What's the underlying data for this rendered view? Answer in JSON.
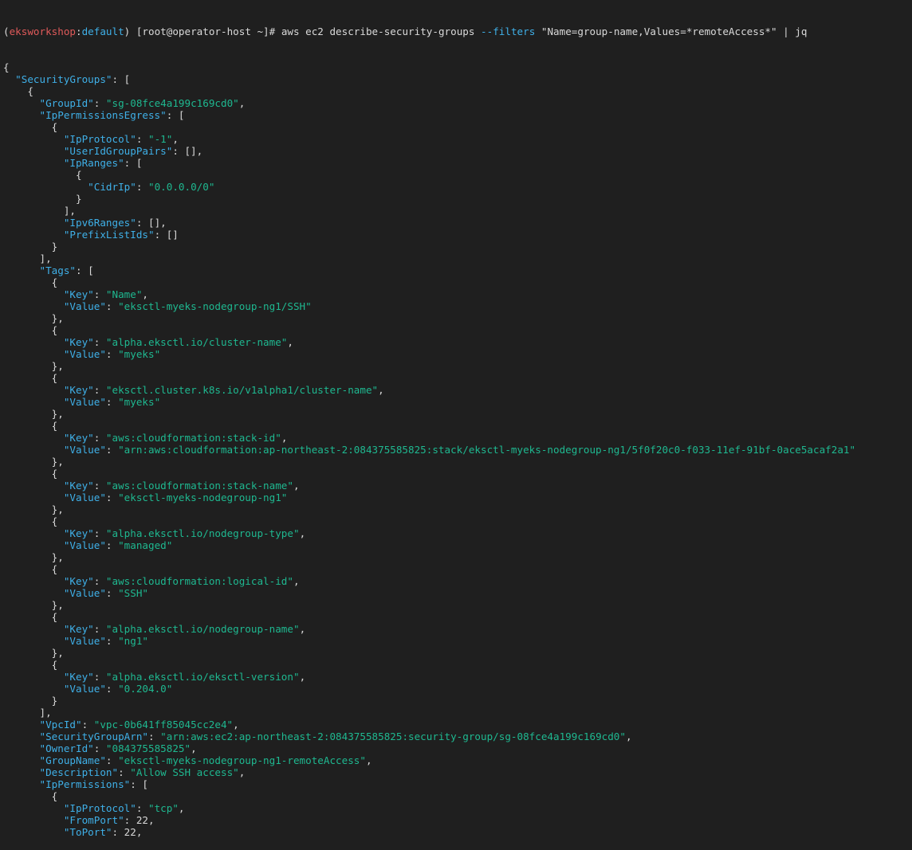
{
  "colors": {
    "background": "#1f1f1f",
    "foreground": "#d9d9d9",
    "json_key": "#3fb0e8",
    "json_string": "#1fb890",
    "prompt_context": "#e05a5a",
    "prompt_namespace": "#3fb0e8"
  },
  "prompt": {
    "open_paren": "(",
    "context": "eksworkshop",
    "colon": ":",
    "namespace": "default",
    "close_and_host": ") [root@operator-host ~]# ",
    "cmd_before_flag": "aws ec2 describe-security-groups ",
    "flag": "--filters",
    "cmd_after_flag": " \"Name=group-name,Values=*remoteAccess*\" | jq"
  },
  "lines": [
    [
      {
        "t": "p",
        "v": "{"
      }
    ],
    [
      {
        "t": "p",
        "v": "  "
      },
      {
        "t": "k",
        "v": "\"SecurityGroups\""
      },
      {
        "t": "p",
        "v": ": ["
      }
    ],
    [
      {
        "t": "p",
        "v": "    {"
      }
    ],
    [
      {
        "t": "p",
        "v": "      "
      },
      {
        "t": "k",
        "v": "\"GroupId\""
      },
      {
        "t": "p",
        "v": ": "
      },
      {
        "t": "s",
        "v": "\"sg-08fce4a199c169cd0\""
      },
      {
        "t": "p",
        "v": ","
      }
    ],
    [
      {
        "t": "p",
        "v": "      "
      },
      {
        "t": "k",
        "v": "\"IpPermissionsEgress\""
      },
      {
        "t": "p",
        "v": ": ["
      }
    ],
    [
      {
        "t": "p",
        "v": "        {"
      }
    ],
    [
      {
        "t": "p",
        "v": "          "
      },
      {
        "t": "k",
        "v": "\"IpProtocol\""
      },
      {
        "t": "p",
        "v": ": "
      },
      {
        "t": "s",
        "v": "\"-1\""
      },
      {
        "t": "p",
        "v": ","
      }
    ],
    [
      {
        "t": "p",
        "v": "          "
      },
      {
        "t": "k",
        "v": "\"UserIdGroupPairs\""
      },
      {
        "t": "p",
        "v": ": [],"
      }
    ],
    [
      {
        "t": "p",
        "v": "          "
      },
      {
        "t": "k",
        "v": "\"IpRanges\""
      },
      {
        "t": "p",
        "v": ": ["
      }
    ],
    [
      {
        "t": "p",
        "v": "            {"
      }
    ],
    [
      {
        "t": "p",
        "v": "              "
      },
      {
        "t": "k",
        "v": "\"CidrIp\""
      },
      {
        "t": "p",
        "v": ": "
      },
      {
        "t": "s",
        "v": "\"0.0.0.0/0\""
      }
    ],
    [
      {
        "t": "p",
        "v": "            }"
      }
    ],
    [
      {
        "t": "p",
        "v": "          ],"
      }
    ],
    [
      {
        "t": "p",
        "v": "          "
      },
      {
        "t": "k",
        "v": "\"Ipv6Ranges\""
      },
      {
        "t": "p",
        "v": ": [],"
      }
    ],
    [
      {
        "t": "p",
        "v": "          "
      },
      {
        "t": "k",
        "v": "\"PrefixListIds\""
      },
      {
        "t": "p",
        "v": ": []"
      }
    ],
    [
      {
        "t": "p",
        "v": "        }"
      }
    ],
    [
      {
        "t": "p",
        "v": "      ],"
      }
    ],
    [
      {
        "t": "p",
        "v": "      "
      },
      {
        "t": "k",
        "v": "\"Tags\""
      },
      {
        "t": "p",
        "v": ": ["
      }
    ],
    [
      {
        "t": "p",
        "v": "        {"
      }
    ],
    [
      {
        "t": "p",
        "v": "          "
      },
      {
        "t": "k",
        "v": "\"Key\""
      },
      {
        "t": "p",
        "v": ": "
      },
      {
        "t": "s",
        "v": "\"Name\""
      },
      {
        "t": "p",
        "v": ","
      }
    ],
    [
      {
        "t": "p",
        "v": "          "
      },
      {
        "t": "k",
        "v": "\"Value\""
      },
      {
        "t": "p",
        "v": ": "
      },
      {
        "t": "s",
        "v": "\"eksctl-myeks-nodegroup-ng1/SSH\""
      }
    ],
    [
      {
        "t": "p",
        "v": "        },"
      }
    ],
    [
      {
        "t": "p",
        "v": "        {"
      }
    ],
    [
      {
        "t": "p",
        "v": "          "
      },
      {
        "t": "k",
        "v": "\"Key\""
      },
      {
        "t": "p",
        "v": ": "
      },
      {
        "t": "s",
        "v": "\"alpha.eksctl.io/cluster-name\""
      },
      {
        "t": "p",
        "v": ","
      }
    ],
    [
      {
        "t": "p",
        "v": "          "
      },
      {
        "t": "k",
        "v": "\"Value\""
      },
      {
        "t": "p",
        "v": ": "
      },
      {
        "t": "s",
        "v": "\"myeks\""
      }
    ],
    [
      {
        "t": "p",
        "v": "        },"
      }
    ],
    [
      {
        "t": "p",
        "v": "        {"
      }
    ],
    [
      {
        "t": "p",
        "v": "          "
      },
      {
        "t": "k",
        "v": "\"Key\""
      },
      {
        "t": "p",
        "v": ": "
      },
      {
        "t": "s",
        "v": "\"eksctl.cluster.k8s.io/v1alpha1/cluster-name\""
      },
      {
        "t": "p",
        "v": ","
      }
    ],
    [
      {
        "t": "p",
        "v": "          "
      },
      {
        "t": "k",
        "v": "\"Value\""
      },
      {
        "t": "p",
        "v": ": "
      },
      {
        "t": "s",
        "v": "\"myeks\""
      }
    ],
    [
      {
        "t": "p",
        "v": "        },"
      }
    ],
    [
      {
        "t": "p",
        "v": "        {"
      }
    ],
    [
      {
        "t": "p",
        "v": "          "
      },
      {
        "t": "k",
        "v": "\"Key\""
      },
      {
        "t": "p",
        "v": ": "
      },
      {
        "t": "s",
        "v": "\"aws:cloudformation:stack-id\""
      },
      {
        "t": "p",
        "v": ","
      }
    ],
    [
      {
        "t": "p",
        "v": "          "
      },
      {
        "t": "k",
        "v": "\"Value\""
      },
      {
        "t": "p",
        "v": ": "
      },
      {
        "t": "s",
        "v": "\"arn:aws:cloudformation:ap-northeast-2:084375585825:stack/eksctl-myeks-nodegroup-ng1/5f0f20c0-f033-11ef-91bf-0ace5acaf2a1\""
      }
    ],
    [
      {
        "t": "p",
        "v": "        },"
      }
    ],
    [
      {
        "t": "p",
        "v": "        {"
      }
    ],
    [
      {
        "t": "p",
        "v": "          "
      },
      {
        "t": "k",
        "v": "\"Key\""
      },
      {
        "t": "p",
        "v": ": "
      },
      {
        "t": "s",
        "v": "\"aws:cloudformation:stack-name\""
      },
      {
        "t": "p",
        "v": ","
      }
    ],
    [
      {
        "t": "p",
        "v": "          "
      },
      {
        "t": "k",
        "v": "\"Value\""
      },
      {
        "t": "p",
        "v": ": "
      },
      {
        "t": "s",
        "v": "\"eksctl-myeks-nodegroup-ng1\""
      }
    ],
    [
      {
        "t": "p",
        "v": "        },"
      }
    ],
    [
      {
        "t": "p",
        "v": "        {"
      }
    ],
    [
      {
        "t": "p",
        "v": "          "
      },
      {
        "t": "k",
        "v": "\"Key\""
      },
      {
        "t": "p",
        "v": ": "
      },
      {
        "t": "s",
        "v": "\"alpha.eksctl.io/nodegroup-type\""
      },
      {
        "t": "p",
        "v": ","
      }
    ],
    [
      {
        "t": "p",
        "v": "          "
      },
      {
        "t": "k",
        "v": "\"Value\""
      },
      {
        "t": "p",
        "v": ": "
      },
      {
        "t": "s",
        "v": "\"managed\""
      }
    ],
    [
      {
        "t": "p",
        "v": "        },"
      }
    ],
    [
      {
        "t": "p",
        "v": "        {"
      }
    ],
    [
      {
        "t": "p",
        "v": "          "
      },
      {
        "t": "k",
        "v": "\"Key\""
      },
      {
        "t": "p",
        "v": ": "
      },
      {
        "t": "s",
        "v": "\"aws:cloudformation:logical-id\""
      },
      {
        "t": "p",
        "v": ","
      }
    ],
    [
      {
        "t": "p",
        "v": "          "
      },
      {
        "t": "k",
        "v": "\"Value\""
      },
      {
        "t": "p",
        "v": ": "
      },
      {
        "t": "s",
        "v": "\"SSH\""
      }
    ],
    [
      {
        "t": "p",
        "v": "        },"
      }
    ],
    [
      {
        "t": "p",
        "v": "        {"
      }
    ],
    [
      {
        "t": "p",
        "v": "          "
      },
      {
        "t": "k",
        "v": "\"Key\""
      },
      {
        "t": "p",
        "v": ": "
      },
      {
        "t": "s",
        "v": "\"alpha.eksctl.io/nodegroup-name\""
      },
      {
        "t": "p",
        "v": ","
      }
    ],
    [
      {
        "t": "p",
        "v": "          "
      },
      {
        "t": "k",
        "v": "\"Value\""
      },
      {
        "t": "p",
        "v": ": "
      },
      {
        "t": "s",
        "v": "\"ng1\""
      }
    ],
    [
      {
        "t": "p",
        "v": "        },"
      }
    ],
    [
      {
        "t": "p",
        "v": "        {"
      }
    ],
    [
      {
        "t": "p",
        "v": "          "
      },
      {
        "t": "k",
        "v": "\"Key\""
      },
      {
        "t": "p",
        "v": ": "
      },
      {
        "t": "s",
        "v": "\"alpha.eksctl.io/eksctl-version\""
      },
      {
        "t": "p",
        "v": ","
      }
    ],
    [
      {
        "t": "p",
        "v": "          "
      },
      {
        "t": "k",
        "v": "\"Value\""
      },
      {
        "t": "p",
        "v": ": "
      },
      {
        "t": "s",
        "v": "\"0.204.0\""
      }
    ],
    [
      {
        "t": "p",
        "v": "        }"
      }
    ],
    [
      {
        "t": "p",
        "v": "      ],"
      }
    ],
    [
      {
        "t": "p",
        "v": "      "
      },
      {
        "t": "k",
        "v": "\"VpcId\""
      },
      {
        "t": "p",
        "v": ": "
      },
      {
        "t": "s",
        "v": "\"vpc-0b641ff85045cc2e4\""
      },
      {
        "t": "p",
        "v": ","
      }
    ],
    [
      {
        "t": "p",
        "v": "      "
      },
      {
        "t": "k",
        "v": "\"SecurityGroupArn\""
      },
      {
        "t": "p",
        "v": ": "
      },
      {
        "t": "s",
        "v": "\"arn:aws:ec2:ap-northeast-2:084375585825:security-group/sg-08fce4a199c169cd0\""
      },
      {
        "t": "p",
        "v": ","
      }
    ],
    [
      {
        "t": "p",
        "v": "      "
      },
      {
        "t": "k",
        "v": "\"OwnerId\""
      },
      {
        "t": "p",
        "v": ": "
      },
      {
        "t": "s",
        "v": "\"084375585825\""
      },
      {
        "t": "p",
        "v": ","
      }
    ],
    [
      {
        "t": "p",
        "v": "      "
      },
      {
        "t": "k",
        "v": "\"GroupName\""
      },
      {
        "t": "p",
        "v": ": "
      },
      {
        "t": "s",
        "v": "\"eksctl-myeks-nodegroup-ng1-remoteAccess\""
      },
      {
        "t": "p",
        "v": ","
      }
    ],
    [
      {
        "t": "p",
        "v": "      "
      },
      {
        "t": "k",
        "v": "\"Description\""
      },
      {
        "t": "p",
        "v": ": "
      },
      {
        "t": "s",
        "v": "\"Allow SSH access\""
      },
      {
        "t": "p",
        "v": ","
      }
    ],
    [
      {
        "t": "p",
        "v": "      "
      },
      {
        "t": "k",
        "v": "\"IpPermissions\""
      },
      {
        "t": "p",
        "v": ": ["
      }
    ],
    [
      {
        "t": "p",
        "v": "        {"
      }
    ],
    [
      {
        "t": "p",
        "v": "          "
      },
      {
        "t": "k",
        "v": "\"IpProtocol\""
      },
      {
        "t": "p",
        "v": ": "
      },
      {
        "t": "s",
        "v": "\"tcp\""
      },
      {
        "t": "p",
        "v": ","
      }
    ],
    [
      {
        "t": "p",
        "v": "          "
      },
      {
        "t": "k",
        "v": "\"FromPort\""
      },
      {
        "t": "p",
        "v": ": "
      },
      {
        "t": "n",
        "v": "22"
      },
      {
        "t": "p",
        "v": ","
      }
    ],
    [
      {
        "t": "p",
        "v": "          "
      },
      {
        "t": "k",
        "v": "\"ToPort\""
      },
      {
        "t": "p",
        "v": ": "
      },
      {
        "t": "n",
        "v": "22"
      },
      {
        "t": "p",
        "v": ","
      }
    ]
  ]
}
